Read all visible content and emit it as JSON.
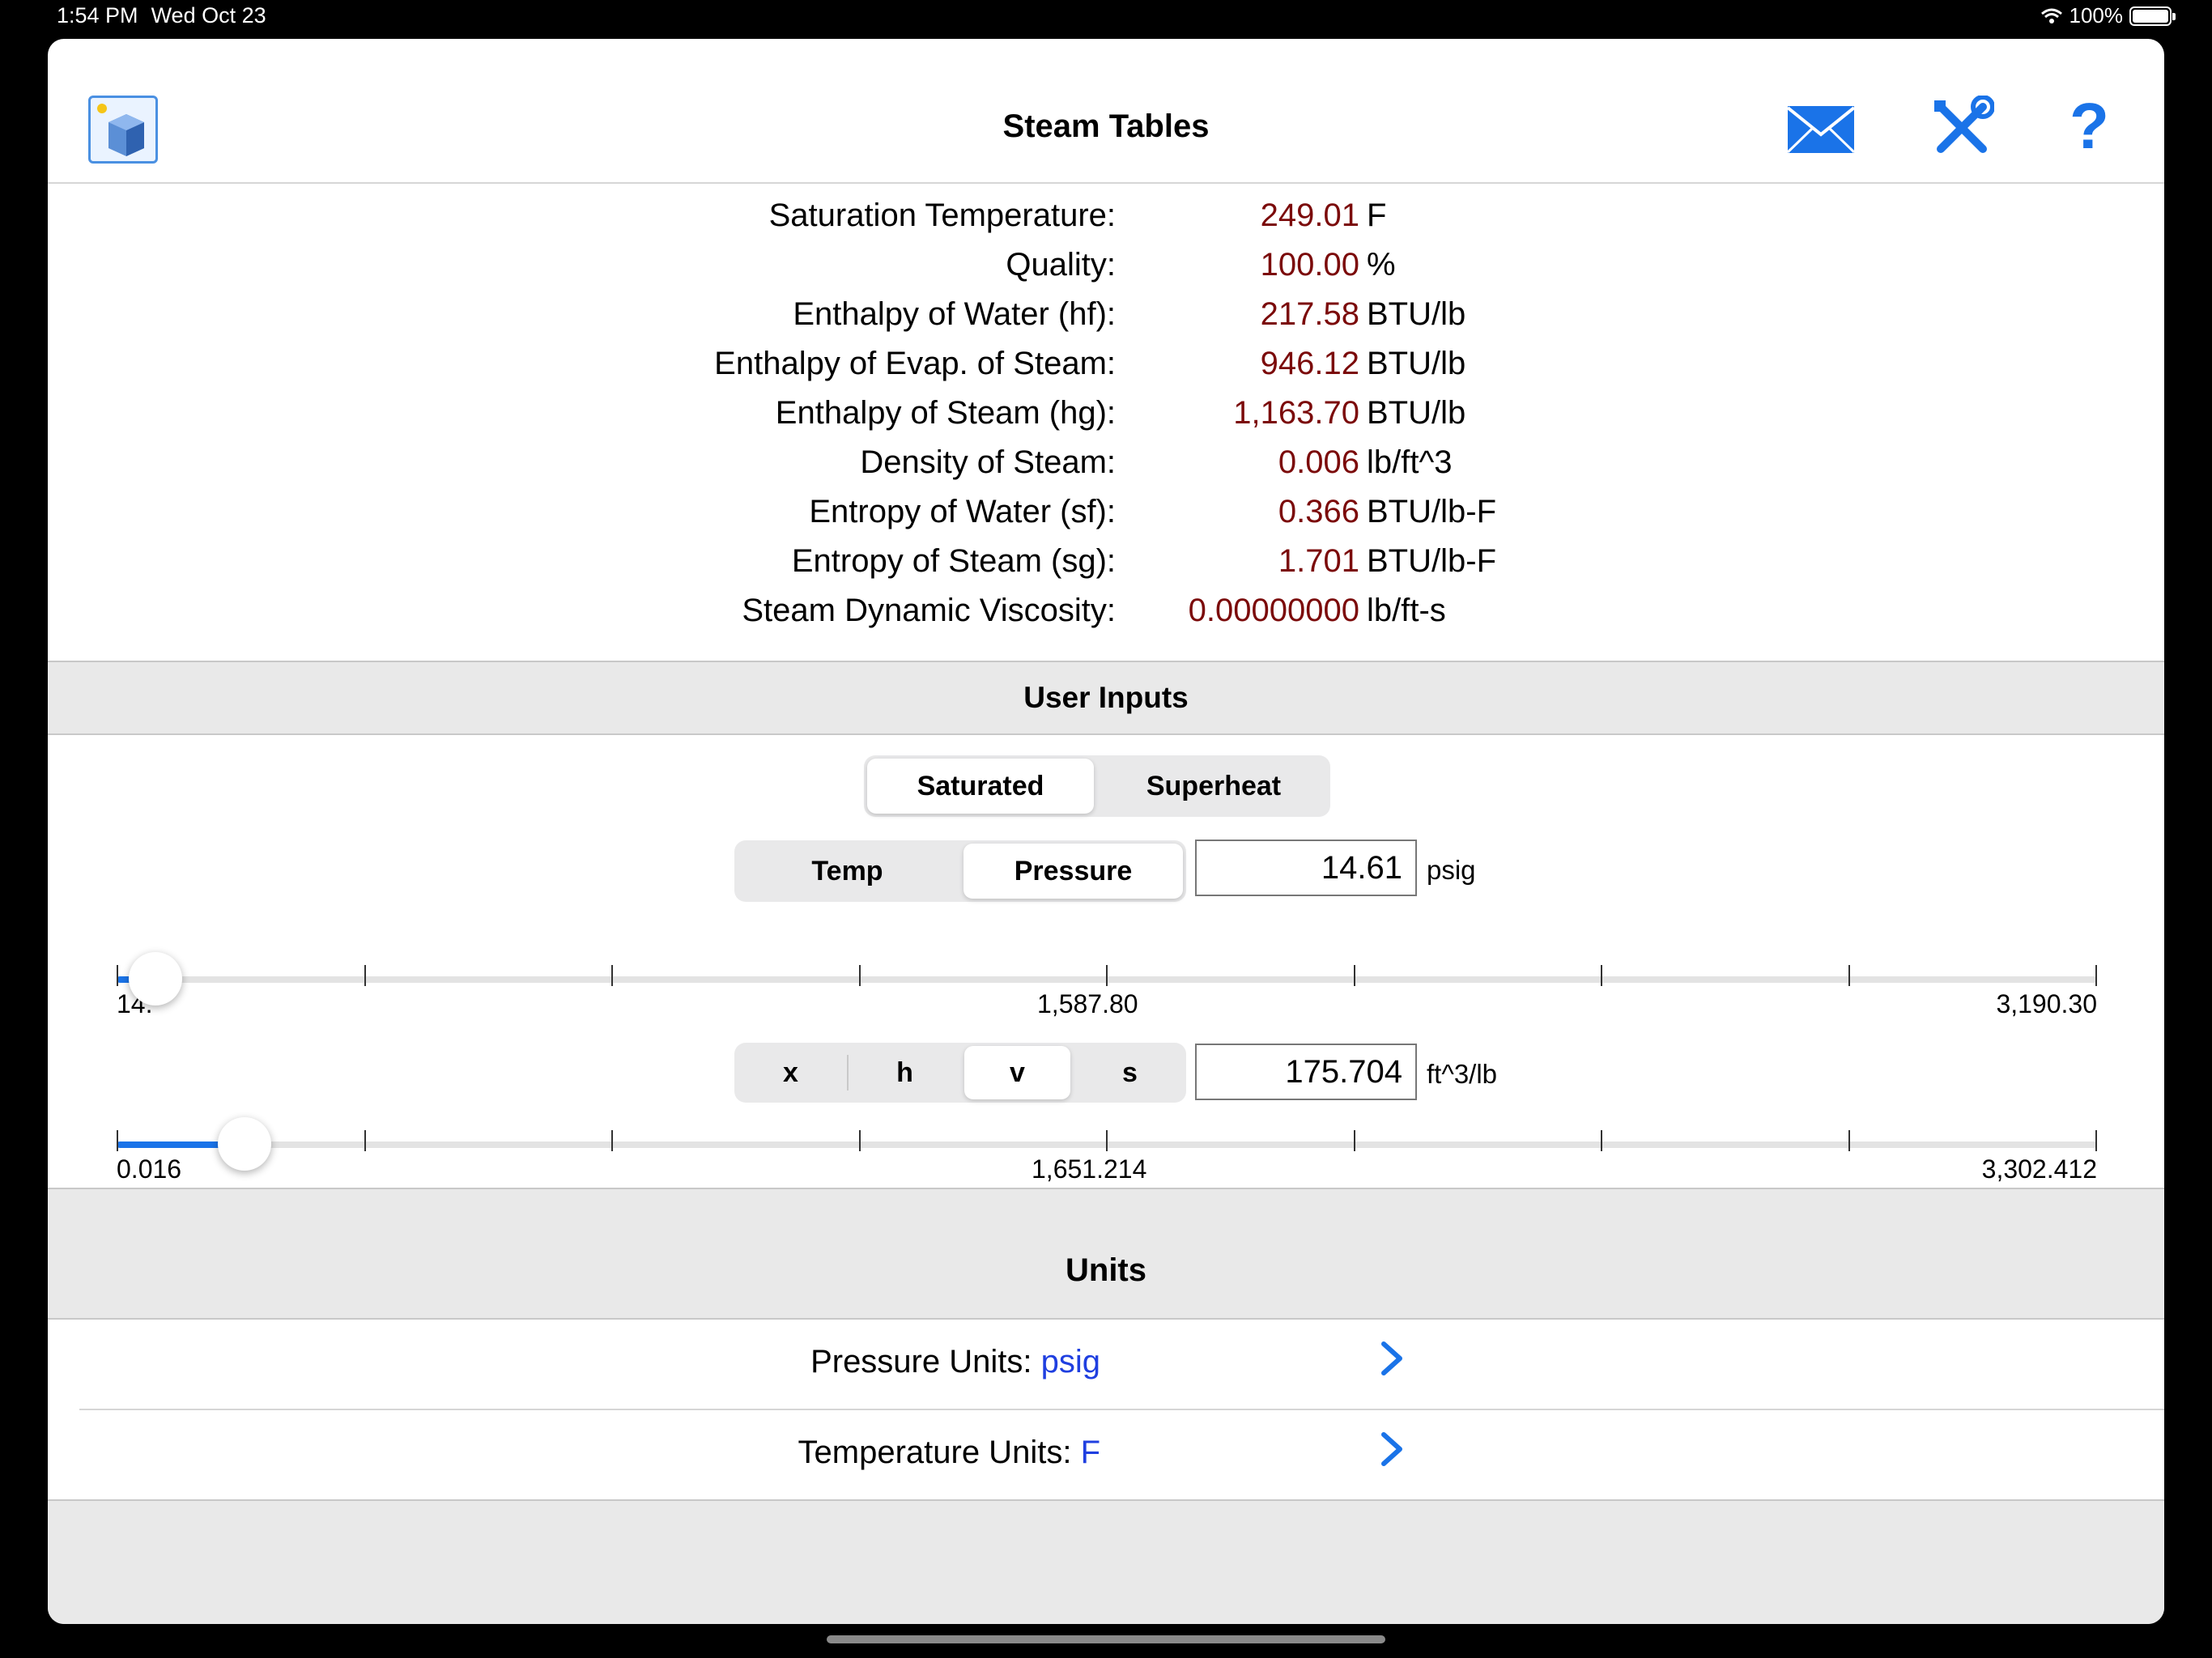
{
  "status_bar": {
    "time": "1:54 PM",
    "date": "Wed Oct 23",
    "battery": "100%"
  },
  "nav": {
    "title": "Steam Tables",
    "icons": [
      "app-icon",
      "mail-icon",
      "tools-icon",
      "help-icon"
    ],
    "help_label": "?"
  },
  "results": [
    {
      "label": "Saturation Temperature:",
      "value": "249.01",
      "unit": "F"
    },
    {
      "label": "Quality:",
      "value": "100.00",
      "unit": "%"
    },
    {
      "label": "Enthalpy of Water (hf):",
      "value": "217.58",
      "unit": "BTU/lb"
    },
    {
      "label": "Enthalpy of Evap. of Steam:",
      "value": "946.12",
      "unit": "BTU/lb"
    },
    {
      "label": "Enthalpy of Steam (hg):",
      "value": "1,163.70",
      "unit": "BTU/lb"
    },
    {
      "label": "Density of Steam:",
      "value": "0.006",
      "unit": "lb/ft^3"
    },
    {
      "label": "Entropy of Water (sf):",
      "value": "0.366",
      "unit": "BTU/lb-F"
    },
    {
      "label": "Entropy of Steam (sg):",
      "value": "1.701",
      "unit": "BTU/lb-F"
    },
    {
      "label": "Steam Dynamic Viscosity:",
      "value": "0.00000000",
      "unit": "lb/ft-s"
    }
  ],
  "inputs": {
    "header": "User Inputs",
    "mode": {
      "options": [
        "Saturated",
        "Superheat"
      ],
      "selected": "Saturated"
    },
    "basis": {
      "options": [
        "Temp",
        "Pressure"
      ],
      "selected": "Pressure"
    },
    "pressure": {
      "value": "14.61",
      "unit": "psig"
    },
    "pressure_slider": {
      "min_label": "14.",
      "mid_label": "1,587.80",
      "max_label": "3,190.30",
      "level": 0.008
    },
    "property": {
      "options": [
        "x",
        "h",
        "v",
        "s"
      ],
      "selected": "v"
    },
    "property_value": {
      "value": "175.704",
      "unit": "ft^3/lb"
    },
    "property_slider": {
      "min_label": "0.016",
      "mid_label": "1,651.214",
      "max_label": "3,302.412",
      "level": 0.053
    }
  },
  "units": {
    "header": "Units",
    "rows": [
      {
        "label": "Pressure Units:",
        "value": "psig"
      },
      {
        "label": "Temperature Units:",
        "value": "F"
      }
    ]
  }
}
